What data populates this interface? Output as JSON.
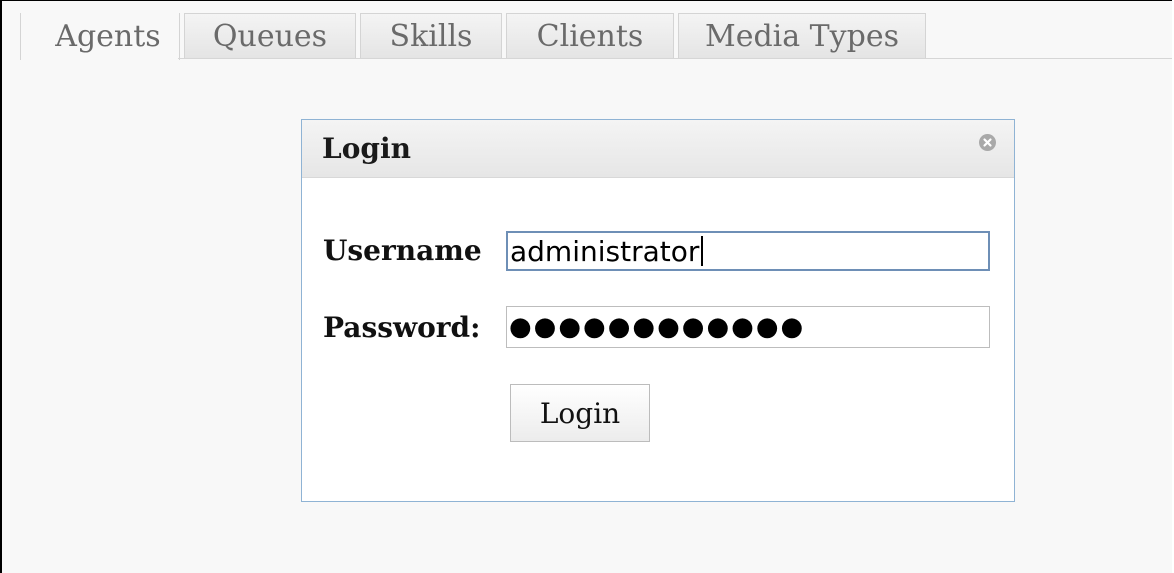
{
  "tabs": [
    {
      "label": "Agents",
      "active": true
    },
    {
      "label": "Queues",
      "active": false
    },
    {
      "label": "Skills",
      "active": false
    },
    {
      "label": "Clients",
      "active": false
    },
    {
      "label": "Media Types",
      "active": false
    }
  ],
  "dialog": {
    "title": "Login",
    "close_icon": "close-circle-icon",
    "username_label": "Username",
    "username_value": "administrator",
    "password_label": "Password:",
    "password_mask": "●●●●●●●●●●●●",
    "login_button": "Login"
  },
  "colors": {
    "dialog_border": "#8fb3d4",
    "focused_input_border": "#6e8fb6",
    "tab_text": "#6a6a6a"
  }
}
